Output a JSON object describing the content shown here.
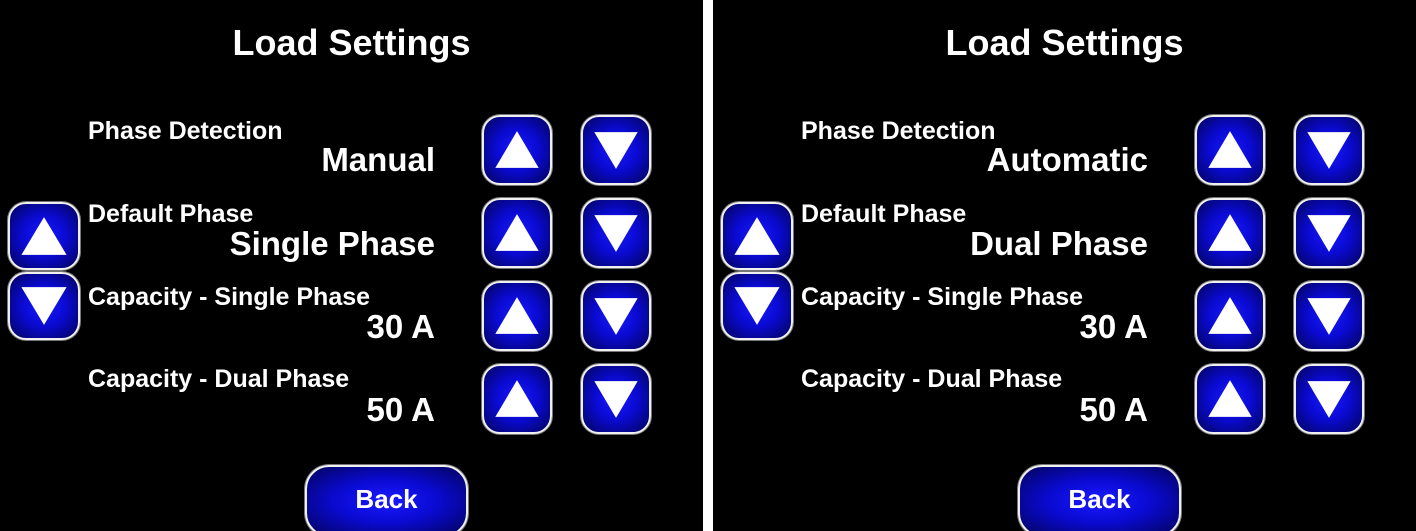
{
  "screens": [
    {
      "title": "Load Settings",
      "settings": [
        {
          "label": "Phase Detection",
          "value": "Manual"
        },
        {
          "label": "Default Phase",
          "value": "Single Phase"
        },
        {
          "label": "Capacity - Single Phase",
          "value": "30 A"
        },
        {
          "label": "Capacity - Dual Phase",
          "value": "50 A"
        }
      ],
      "back_label": "Back"
    },
    {
      "title": "Load Settings",
      "settings": [
        {
          "label": "Phase Detection",
          "value": "Automatic"
        },
        {
          "label": "Default Phase",
          "value": "Dual Phase"
        },
        {
          "label": "Capacity - Single Phase",
          "value": "30 A"
        },
        {
          "label": "Capacity - Dual Phase",
          "value": "50 A"
        }
      ],
      "back_label": "Back"
    }
  ],
  "icons": {
    "up": "arrow-up-icon",
    "down": "arrow-down-icon"
  },
  "colors": {
    "background": "#000000",
    "button_blue": "#0a0ad2",
    "button_border": "#f0f0f0",
    "text": "#ffffff"
  }
}
